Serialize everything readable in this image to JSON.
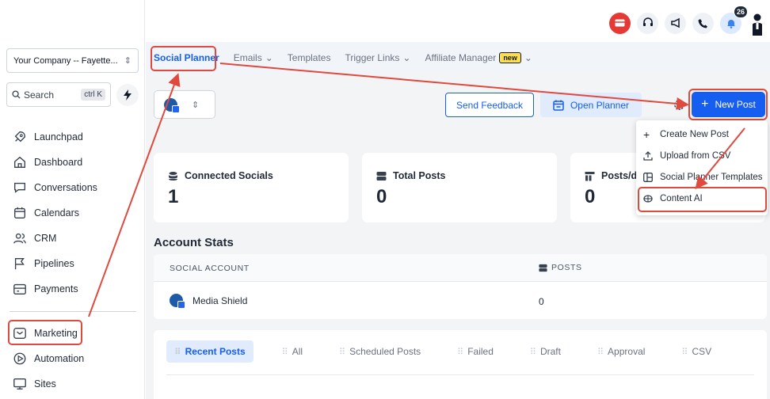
{
  "sidebar": {
    "company": "Your Company -- Fayette...",
    "search": {
      "label": "Search",
      "shortcut": "ctrl K"
    },
    "items": [
      {
        "label": "Launchpad",
        "icon": "rocket-icon"
      },
      {
        "label": "Dashboard",
        "icon": "home-icon"
      },
      {
        "label": "Conversations",
        "icon": "chat-icon"
      },
      {
        "label": "Calendars",
        "icon": "calendar-icon"
      },
      {
        "label": "CRM",
        "icon": "users-icon"
      },
      {
        "label": "Pipelines",
        "icon": "flag-icon"
      },
      {
        "label": "Payments",
        "icon": "wallet-icon"
      }
    ],
    "items2": [
      {
        "label": "Marketing",
        "icon": "mail-icon"
      },
      {
        "label": "Automation",
        "icon": "play-icon"
      },
      {
        "label": "Sites",
        "icon": "monitor-icon"
      }
    ]
  },
  "topbar": {
    "notification_count": "26"
  },
  "tabs": [
    {
      "label": "Social Planner"
    },
    {
      "label": "Emails"
    },
    {
      "label": "Templates"
    },
    {
      "label": "Trigger Links"
    },
    {
      "label": "Affiliate Manager",
      "badge": "new"
    }
  ],
  "toolbar": {
    "feedback": "Send Feedback",
    "planner": "Open Planner",
    "new_post": "New Post"
  },
  "stats": [
    {
      "title": "Connected Socials",
      "value": "1"
    },
    {
      "title": "Total Posts",
      "value": "0"
    },
    {
      "title": "Posts/d",
      "value": "0"
    }
  ],
  "account_stats": {
    "title": "Account Stats",
    "col_social": "SOCIAL ACCOUNT",
    "col_posts": "POSTS",
    "rows": [
      {
        "name": "Media Shield",
        "posts": "0"
      }
    ]
  },
  "post_filters": [
    "Recent Posts",
    "All",
    "Scheduled Posts",
    "Failed",
    "Draft",
    "Approval",
    "CSV"
  ],
  "dropdown": [
    {
      "label": "Create New Post",
      "icon": "plus-icon"
    },
    {
      "label": "Upload from CSV",
      "icon": "upload-icon"
    },
    {
      "label": "Social Planner Templates",
      "icon": "template-icon"
    },
    {
      "label": "Content AI",
      "icon": "ai-icon"
    }
  ],
  "colors": {
    "primary": "#155eef",
    "annotation": "#e0493e",
    "alert": "#e53935"
  }
}
